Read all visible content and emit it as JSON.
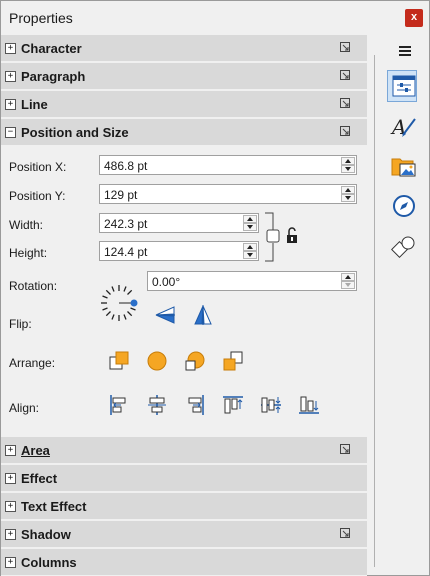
{
  "window": {
    "title": "Properties",
    "close_label": "x"
  },
  "sections_top": [
    {
      "label": "Character",
      "expander": "+"
    },
    {
      "label": "Paragraph",
      "expander": "+"
    },
    {
      "label": "Line",
      "expander": "+"
    },
    {
      "label": "Position and Size",
      "expander": "−"
    }
  ],
  "position_size": {
    "position_x": {
      "label": "Position X:",
      "value": "486.8 pt"
    },
    "position_y": {
      "label": "Position Y:",
      "value": "129 pt"
    },
    "width": {
      "label": "Width:",
      "value": "242.3 pt"
    },
    "height": {
      "label": "Height:",
      "value": "124.4 pt"
    },
    "rotation": {
      "label": "Rotation:",
      "value": "0.00°"
    },
    "flip_label": "Flip:",
    "arrange_label": "Arrange:",
    "align_label": "Align:"
  },
  "sections_bottom": [
    {
      "label": "Area",
      "expander": "+"
    },
    {
      "label": "Effect",
      "expander": "+"
    },
    {
      "label": "Text Effect",
      "expander": "+"
    },
    {
      "label": "Shadow",
      "expander": "+"
    },
    {
      "label": "Columns",
      "expander": "+"
    }
  ],
  "colors": {
    "accent_orange": "#f5a623",
    "accent_blue": "#2a6fc9",
    "section_bg": "#d9d9d9"
  },
  "sidebar": {
    "icons": [
      "menu-icon",
      "properties-icon",
      "styles-icon",
      "gallery-icon",
      "navigator-icon",
      "shapes-icon"
    ],
    "selected": "properties-icon"
  }
}
